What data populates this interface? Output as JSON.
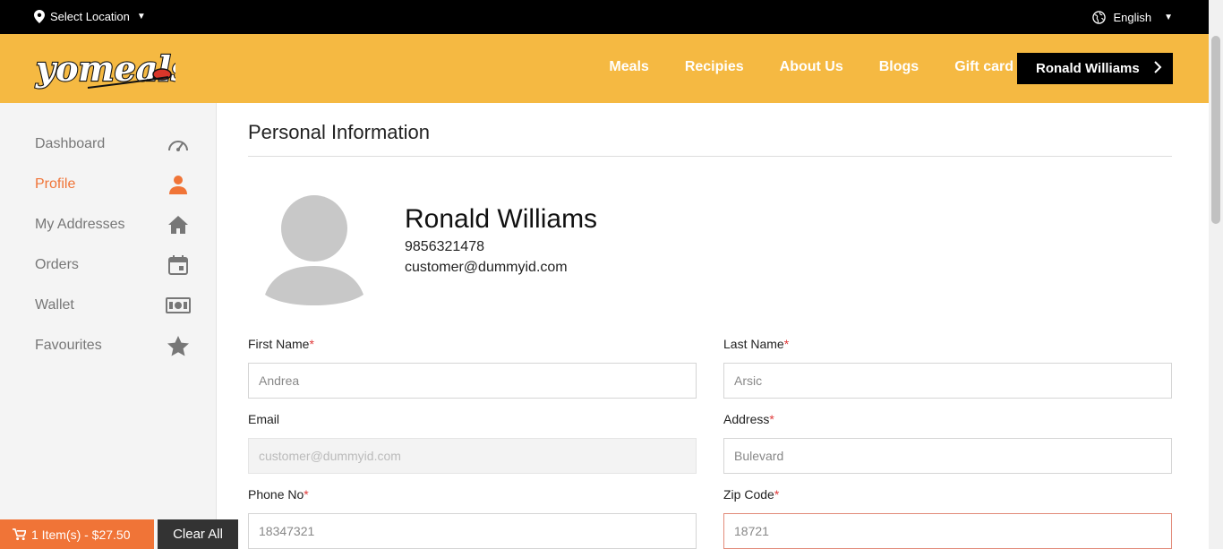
{
  "topbar": {
    "location_label": "Select Location",
    "language": "English"
  },
  "brand": {
    "logo_text": "yomeals",
    "accent": "#f5b942",
    "active_color": "#f07437"
  },
  "nav": {
    "items": [
      "Meals",
      "Recipies",
      "About Us",
      "Blogs",
      "Gift card"
    ],
    "user_button": "Ronald Williams"
  },
  "sidebar": {
    "items": [
      {
        "label": "Dashboard",
        "icon": "speedometer-icon"
      },
      {
        "label": "Profile",
        "icon": "person-icon",
        "active": true
      },
      {
        "label": "My Addresses",
        "icon": "home-icon"
      },
      {
        "label": "Orders",
        "icon": "calendar-icon"
      },
      {
        "label": "Wallet",
        "icon": "money-icon"
      },
      {
        "label": "Favourites",
        "icon": "star-icon"
      }
    ]
  },
  "main": {
    "title": "Personal Information",
    "profile": {
      "name": "Ronald Williams",
      "phone": "9856321478",
      "email": "customer@dummyid.com"
    },
    "form": {
      "first_name": {
        "label": "First Name",
        "required": "*",
        "value": "Andrea"
      },
      "last_name": {
        "label": "Last Name",
        "required": "*",
        "value": "Arsic"
      },
      "email": {
        "label": "Email",
        "value": "customer@dummyid.com"
      },
      "address": {
        "label": "Address",
        "required": "*",
        "value": "Bulevard"
      },
      "phone": {
        "label": "Phone No",
        "required": "*",
        "value": "18347321"
      },
      "zip": {
        "label": "Zip Code",
        "required": "*",
        "value": "18721"
      }
    }
  },
  "cart": {
    "summary": "1 Item(s) - $27.50",
    "clear_label": "Clear All"
  }
}
